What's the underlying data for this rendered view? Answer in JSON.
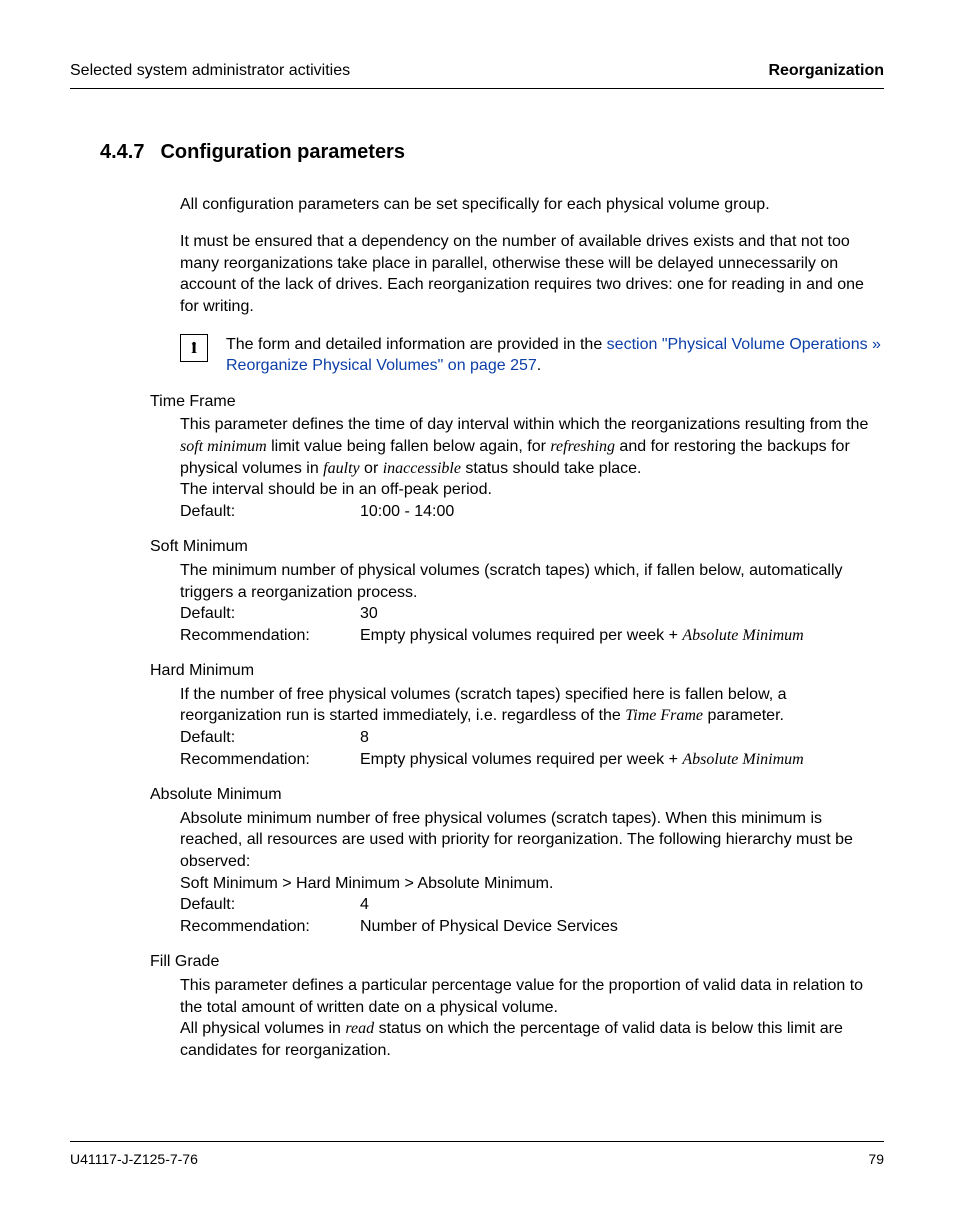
{
  "header": {
    "left": "Selected system administrator activities",
    "right": "Reorganization"
  },
  "section": {
    "number": "4.4.7",
    "title": "Configuration parameters"
  },
  "intro1": "All configuration parameters can be set specifically for each physical volume group.",
  "intro2": "It must be ensured that a dependency on the number of available drives exists and that not too many reorganizations take place in parallel, otherwise these will be delayed unnecessarily on account of the lack of drives. Each reorganization requires two drives: one for reading in and one for writing.",
  "info_note": {
    "pre": "The form and detailed information are provided in the ",
    "link": "section \"Physical Volume Operations » Reorganize Physical Volumes\" on page 257",
    "post": "."
  },
  "params": {
    "time_frame": {
      "title": "Time Frame",
      "desc1a": "This parameter defines the time of day interval within which the reorganizations resulting from the ",
      "desc1_em1": "soft minimum",
      "desc1b": " limit value being fallen below again, for ",
      "desc1_em2": "refreshing",
      "desc1c": " and for restoring the backups for physical volumes in ",
      "desc1_em3": "faulty",
      "desc1d": " or ",
      "desc1_em4": "inaccessible",
      "desc1e": " status should take place.",
      "desc2": "The interval should be in an off-peak period.",
      "default_label": "Default:",
      "default_val": "10:00 - 14:00"
    },
    "soft_min": {
      "title": "Soft Minimum",
      "desc": "The minimum number of physical volumes (scratch tapes) which, if fallen below, automatically triggers a reorganization process.",
      "default_label": "Default:",
      "default_val": "30",
      "rec_label": "Recommendation:",
      "rec_val_pre": "Empty physical volumes required per week + ",
      "rec_val_em": "Absolute Minimum"
    },
    "hard_min": {
      "title": "Hard Minimum",
      "desc_a": "If the number of free physical volumes (scratch tapes) specified here is fallen below, a reorganization run is started immediately, i.e. regardless of the ",
      "desc_em": "Time Frame",
      "desc_b": " parameter.",
      "default_label": "Default:",
      "default_val": "8",
      "rec_label": "Recommendation:",
      "rec_val_pre": "Empty physical volumes required per week + ",
      "rec_val_em": "Absolute Minimum"
    },
    "abs_min": {
      "title": "Absolute Minimum",
      "desc": "Absolute minimum number of free physical volumes (scratch tapes). When this minimum is reached, all resources are used with priority for reorganization. The following hierarchy must be observed:",
      "hierarchy": "Soft Minimum > Hard Minimum > Absolute Minimum.",
      "default_label": "Default:",
      "default_val": "4",
      "rec_label": "Recommendation:",
      "rec_val": "Number of Physical Device Services"
    },
    "fill_grade": {
      "title": "Fill Grade",
      "desc1": "This parameter defines a particular percentage value for the proportion of valid data in relation to the total amount of written date on a physical volume.",
      "desc2a": "All physical volumes in ",
      "desc2_em": "read",
      "desc2b": " status on which the percentage of valid data is below this limit are candidates for reorganization."
    }
  },
  "footer": {
    "left": "U41117-J-Z125-7-76",
    "right": "79"
  }
}
